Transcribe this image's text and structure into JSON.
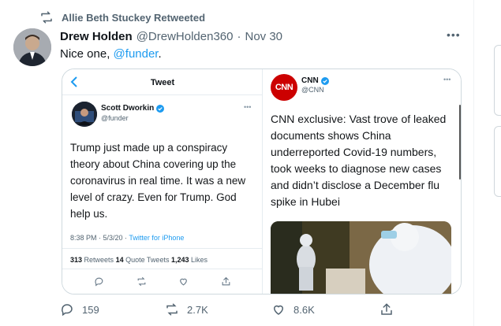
{
  "retweet": {
    "label": "Allie Beth Stuckey Retweeted"
  },
  "tweet": {
    "author_name": "Drew Holden",
    "author_handle": "@DrewHolden360",
    "separator": "·",
    "date": "Nov 30",
    "more": "•••",
    "text_prefix": "Nice one, ",
    "mention": "@funder",
    "text_suffix": "."
  },
  "left_screenshot": {
    "header_title": "Tweet",
    "back_icon": "chevron-left-icon",
    "author_name": "Scott Dworkin",
    "author_handle": "@funder",
    "more": "•••",
    "body": "Trump just made up a conspiracy theory about China covering up the coronavirus in real time. It was a new level of crazy. Even for Trump. God help us.",
    "time": "8:38 PM · 5/3/20 · ",
    "source": "Twitter for iPhone",
    "retweets_count": "313",
    "retweets_label": " Retweets  ",
    "quote_count": "14",
    "quote_label": " Quote Tweets  ",
    "likes_count": "1,243",
    "likes_label": " Likes"
  },
  "right_screenshot": {
    "logo_text": "CNN",
    "author_name": "CNN",
    "author_handle": "@CNN",
    "more": "•••",
    "body": "CNN exclusive: Vast trove of leaked documents shows China underreported Covid-19 numbers, took weeks to diagnose new cases and didn’t disclose a December flu spike in Hubei"
  },
  "actions": {
    "reply_count": "159",
    "retweet_count": "2.7K",
    "like_count": "8.6K"
  },
  "colors": {
    "accent": "#1d9bf0",
    "secondary_text": "#536471",
    "cnn_red": "#cc0000"
  }
}
